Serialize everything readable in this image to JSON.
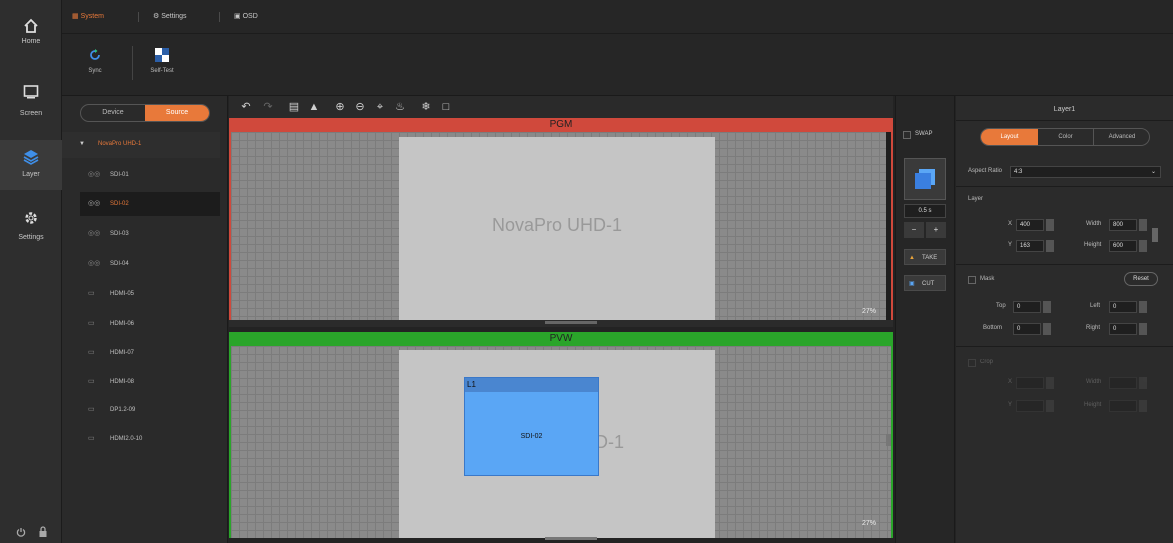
{
  "nav": {
    "items": [
      {
        "label": "Home",
        "icon": "home-icon"
      },
      {
        "label": "Screen",
        "icon": "screen-icon"
      },
      {
        "label": "Layer",
        "icon": "layer-icon"
      },
      {
        "label": "Settings",
        "icon": "settings-icon"
      }
    ]
  },
  "topbar": {
    "tabs": [
      {
        "label": "System"
      },
      {
        "label": "Settings"
      },
      {
        "label": "OSD"
      }
    ]
  },
  "toolstrip": {
    "sync_label": "Sync",
    "selftest_label": "Self-Test"
  },
  "sources": {
    "tab_device": "Device",
    "tab_source": "Source",
    "device_name": "NovaPro UHD-1",
    "items": [
      {
        "label": "SDI-01"
      },
      {
        "label": "SDI-02"
      },
      {
        "label": "SDI-03"
      },
      {
        "label": "SDI-04"
      },
      {
        "label": "HDMI-05"
      },
      {
        "label": "HDMI-06"
      },
      {
        "label": "HDMI-07"
      },
      {
        "label": "HDMI-08"
      },
      {
        "label": "DP1.2-09"
      },
      {
        "label": "HDMI2.0-10"
      }
    ]
  },
  "pgm": {
    "header": "PGM",
    "screen_name": "NovaPro UHD-1",
    "zoom": "27%"
  },
  "pvw": {
    "header": "PVW",
    "screen_name_partial": "D-1",
    "layer_label": "L1",
    "layer_source": "SDI-02",
    "zoom": "27%"
  },
  "mid": {
    "swap_label": "SWAP",
    "time_value": "0.5 s",
    "minus": "−",
    "plus": "+",
    "take_label": "TAKE",
    "cut_label": "CUT"
  },
  "props": {
    "title": "Layer1",
    "tabs": [
      {
        "label": "Layout"
      },
      {
        "label": "Color"
      },
      {
        "label": "Advanced"
      }
    ],
    "aspect_label": "Aspect Ratio",
    "aspect_value": "4:3",
    "layer_section": "Layer",
    "x_label": "X",
    "x_value": "400",
    "y_label": "Y",
    "y_value": "163",
    "width_label": "Width",
    "width_value": "800",
    "height_label": "Height",
    "height_value": "600",
    "mask_label": "Mask",
    "reset_label": "Reset",
    "top_label": "Top",
    "top_value": "0",
    "left_label": "Left",
    "left_value": "0",
    "bottom_label": "Bottom",
    "bottom_value": "0",
    "right_label": "Right",
    "right_value": "0",
    "crop_label": "Crop",
    "crop_x_label": "X",
    "crop_y_label": "Y",
    "crop_width_label": "Width",
    "crop_height_label": "Height"
  },
  "colors": {
    "accent": "#e8793a",
    "pgm_red": "#d0493c",
    "pvw_green": "#2aa52a",
    "layer_blue": "#5aa6f5"
  }
}
